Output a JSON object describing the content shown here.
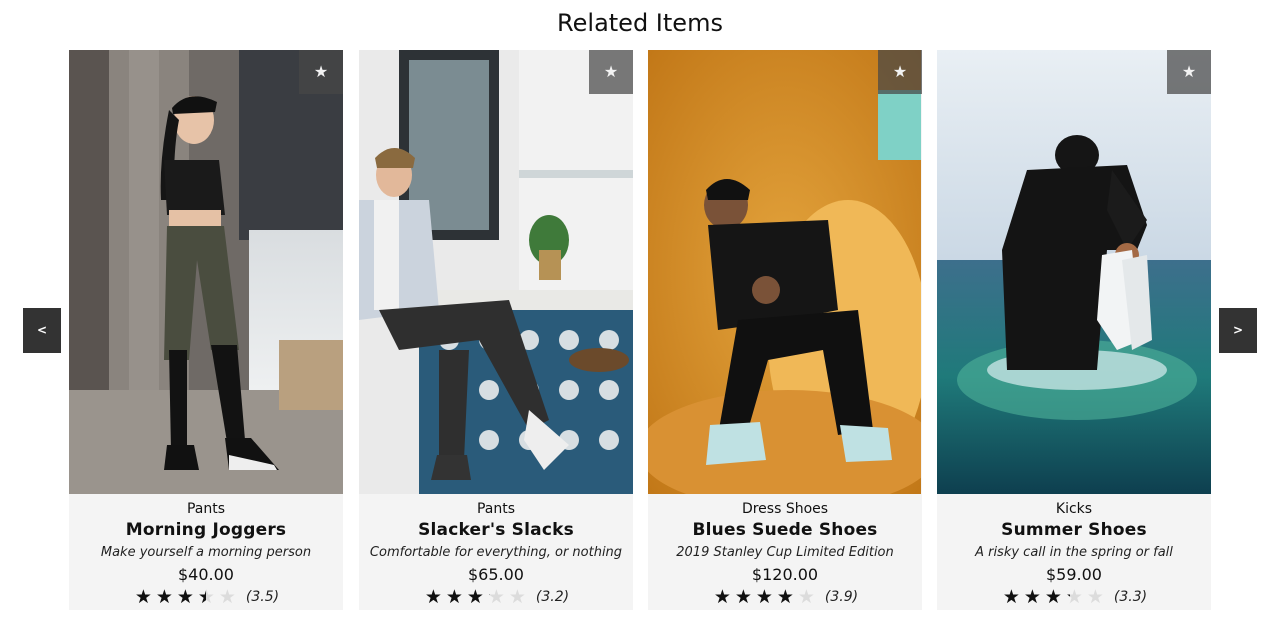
{
  "section": {
    "title": "Related Items"
  },
  "nav": {
    "prev_label": "<",
    "next_label": ">"
  },
  "favorite_icon": "★",
  "star_icon": "★",
  "products": [
    {
      "category": "Pants",
      "name": "Morning Joggers",
      "description": "Make yourself a morning person",
      "price": "$40.00",
      "rating": 3.5,
      "rating_text": "(3.5)",
      "photo": "woman-in-black-crop-top-and-joggers-leaning-on-pillar"
    },
    {
      "category": "Pants",
      "name": "Slacker's Slacks",
      "description": "Comfortable for everything, or nothing",
      "price": "$65.00",
      "rating": 3.2,
      "rating_text": "(3.2)",
      "photo": "man-in-blazer-sitting-on-bar-stool-with-phone"
    },
    {
      "category": "Dress Shoes",
      "name": "Blues Suede Shoes",
      "description": "2019 Stanley Cup Limited Edition",
      "price": "$120.00",
      "rating": 3.9,
      "rating_text": "(3.9)",
      "photo": "man-in-black-sitting-on-fluffy-orange-bean-bag"
    },
    {
      "category": "Kicks",
      "name": "Summer Shoes",
      "description": "A risky call in the spring or fall",
      "price": "$59.00",
      "rating": 3.3,
      "rating_text": "(3.3)",
      "photo": "man-wading-in-sea-holding-white-sneakers"
    }
  ]
}
